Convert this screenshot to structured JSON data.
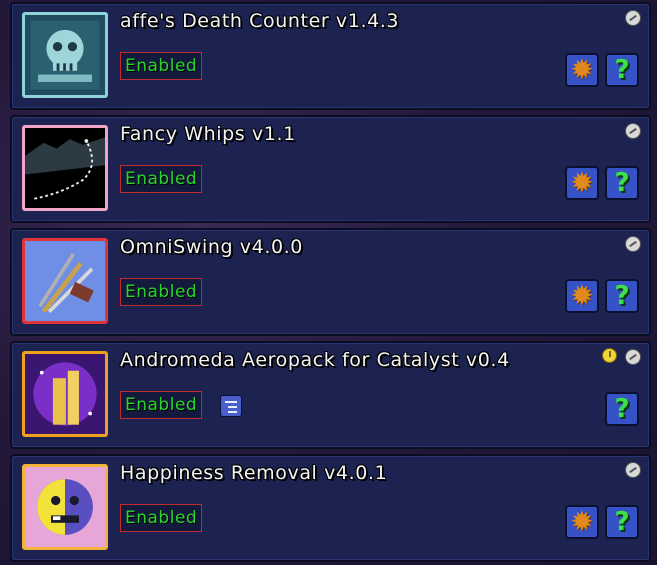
{
  "mods": [
    {
      "title": "affe's Death Counter v1.4.3",
      "status": "Enabled",
      "thumb_border": "#8fd3d8",
      "has_config": true,
      "has_clock": false,
      "has_deps": false
    },
    {
      "title": "Fancy Whips v1.1",
      "status": "Enabled",
      "thumb_border": "#f2a3c6",
      "has_config": true,
      "has_clock": false,
      "has_deps": false
    },
    {
      "title": "OmniSwing v4.0.0",
      "status": "Enabled",
      "thumb_border": "#e0343a",
      "has_config": true,
      "has_clock": false,
      "has_deps": false
    },
    {
      "title": "Andromeda Aeropack for Catalyst v0.4",
      "status": "Enabled",
      "thumb_border": "#f0a21e",
      "has_config": false,
      "has_clock": true,
      "has_deps": true
    },
    {
      "title": "Happiness Removal v4.0.1",
      "status": "Enabled",
      "thumb_border": "#f4b43a",
      "has_config": true,
      "has_clock": false,
      "has_deps": false
    }
  ],
  "icons": {
    "config": "gear-icon",
    "info": "question-mark-icon",
    "workshop": "steam-workshop-icon",
    "update": "clock-icon",
    "dependencies": "dependencies-icon"
  },
  "glyphs": {
    "gear": "✹",
    "help": "?"
  },
  "colors": {
    "panel": "#1d2350",
    "enabled_text": "#2ad52a",
    "enabled_border": "#c02a2a",
    "button": "#3553c6"
  }
}
